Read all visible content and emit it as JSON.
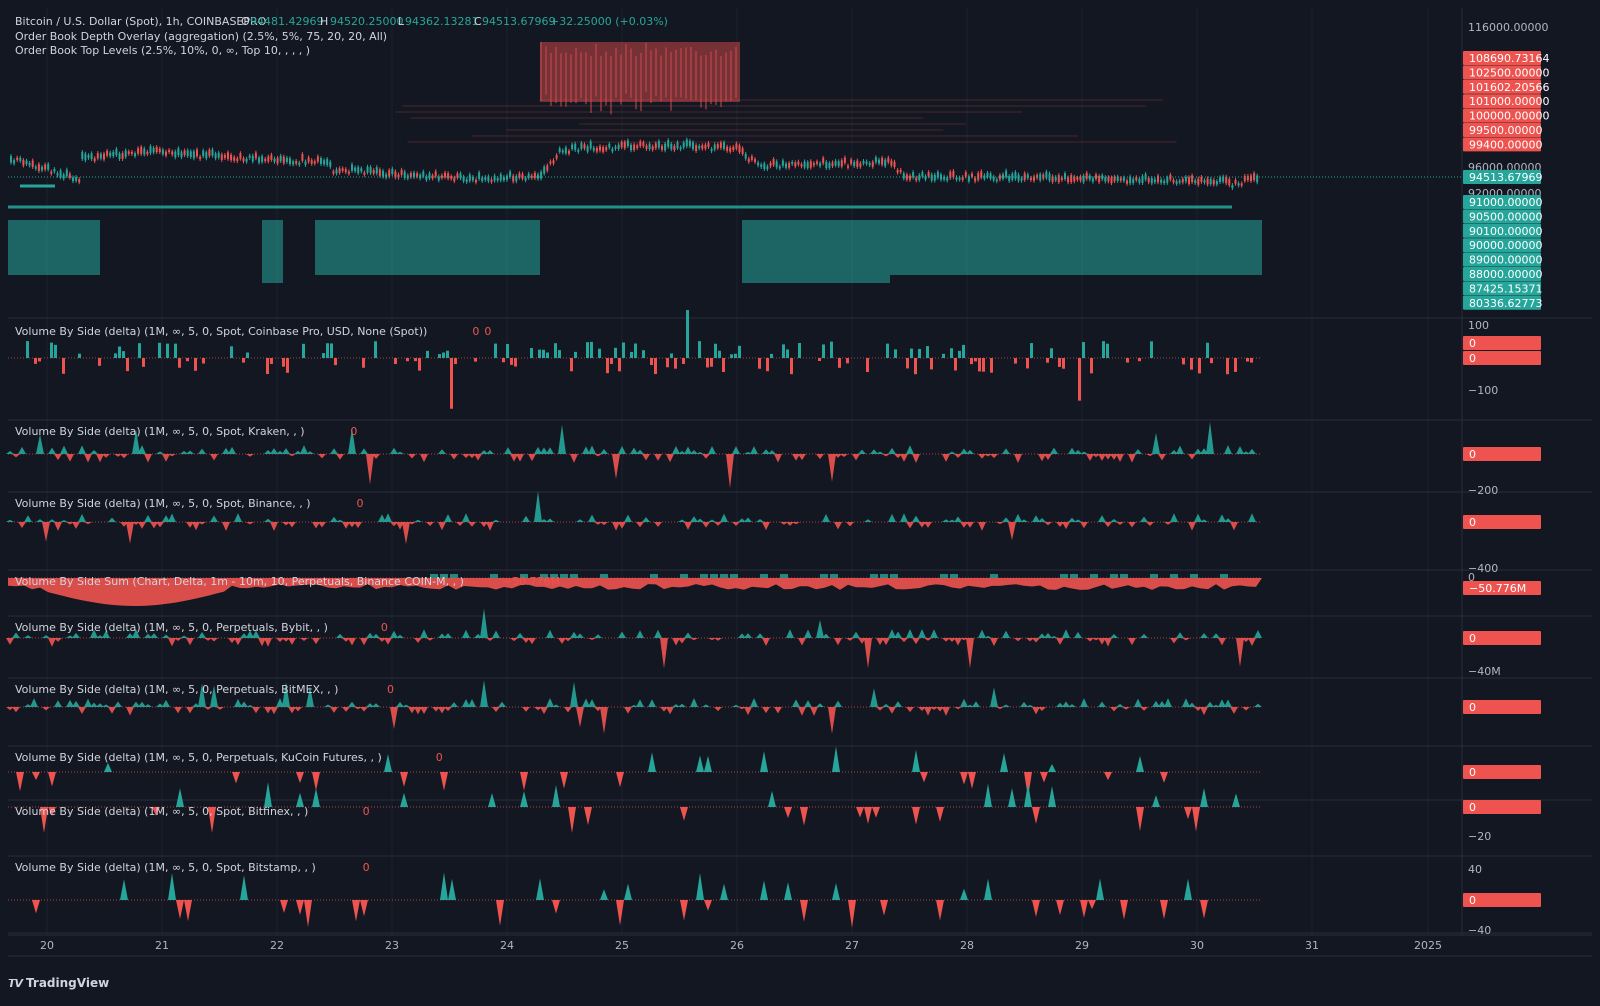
{
  "header": {
    "symbol": "Bitcoin / U.S. Dollar (Spot), 1h, COINBASEPRO",
    "o_label": "O",
    "o_value": "94481.42969",
    "h_label": "H",
    "h_value": "94520.25000",
    "l_label": "L",
    "l_value": "94362.13281",
    "c_label": "C",
    "c_value": "94513.67969",
    "change": "+32.25000 (+0.03%)",
    "indicators": [
      "Order Book Depth Overlay (aggregation) (2.5%, 5%, 75, 20, 20, All)",
      "Order Book Top Levels (2.5%, 10%, 0, ∞, Top 10, , , , )"
    ]
  },
  "price_axis": {
    "ticks": [
      "116000.00000",
      "96000.00000",
      "92000.00000"
    ],
    "ask_levels": [
      "108690.73164",
      "102500.00000",
      "101602.20566",
      "101000.00000",
      "100000.00000",
      "99500.00000",
      "99400.00000"
    ],
    "current": "94513.67969",
    "bid_levels": [
      "91000.00000",
      "90500.00000",
      "90100.00000",
      "90000.00000",
      "89000.00000",
      "88000.00000",
      "87425.15371",
      "80336.62773"
    ]
  },
  "panes": [
    {
      "title": "Volume By Side (delta) (1M, ∞, 5, 0, Spot, Coinbase Pro, USD, None (Spot))",
      "vals": [
        "0",
        "0"
      ],
      "axis": [
        "100",
        "−100"
      ],
      "badges": [
        "0",
        "0"
      ]
    },
    {
      "title": "Volume By Side (delta) (1M, ∞, 5, 0, Spot, Kraken, , )",
      "vals": [
        "0"
      ],
      "axis": [
        "−200"
      ],
      "badges": [
        "0"
      ]
    },
    {
      "title": "Volume By Side (delta) (1M, ∞, 5, 0, Spot, Binance, , )",
      "vals": [
        "0"
      ],
      "axis": [
        "−400"
      ],
      "badges": [
        "0"
      ]
    },
    {
      "title": "Volume By Side Sum (Chart, Delta, 1m - 10m, 10, Perpetuals, Binance COIN-M, , )",
      "vals": [
        "−50.776M"
      ],
      "axis": [
        "0"
      ],
      "badges": [
        "−50.776M"
      ]
    },
    {
      "title": "Volume By Side (delta) (1M, ∞, 5, 0, Perpetuals, Bybit, , )",
      "vals": [
        "0"
      ],
      "axis": [
        "−40M"
      ],
      "badges": [
        "0"
      ]
    },
    {
      "title": "Volume By Side (delta) (1M, ∞, 5, 0, Perpetuals, BitMEX, , )",
      "vals": [
        "0"
      ],
      "axis": [],
      "badges": [
        "0"
      ]
    },
    {
      "title": "Volume By Side (delta) (1M, ∞, 5, 0, Perpetuals, KuCoin Futures, , )",
      "vals": [
        "0"
      ],
      "axis": [],
      "badges": [
        "0"
      ]
    },
    {
      "title": "Volume By Side (delta) (1M, ∞, 5, 0, Spot, Bitfinex, , )",
      "vals": [
        "0"
      ],
      "axis": [
        "−20"
      ],
      "badges": [
        "0"
      ]
    },
    {
      "title": "Volume By Side (delta) (1M, ∞, 5, 0, Spot, Bitstamp, , )",
      "vals": [
        "0"
      ],
      "axis": [
        "40",
        "−40"
      ],
      "badges": [
        "0"
      ]
    }
  ],
  "time_axis": [
    "20",
    "21",
    "22",
    "23",
    "24",
    "25",
    "26",
    "27",
    "28",
    "29",
    "30",
    "31",
    "2025"
  ],
  "brand": "TradingView",
  "colors": {
    "background": "#131722",
    "up": "#26a69a",
    "down": "#ef5350",
    "text": "#d1d4dc",
    "axis_text": "#b2b5be",
    "grid": "#1e222d"
  },
  "icons": [
    "tradingview-logo-icon"
  ]
}
